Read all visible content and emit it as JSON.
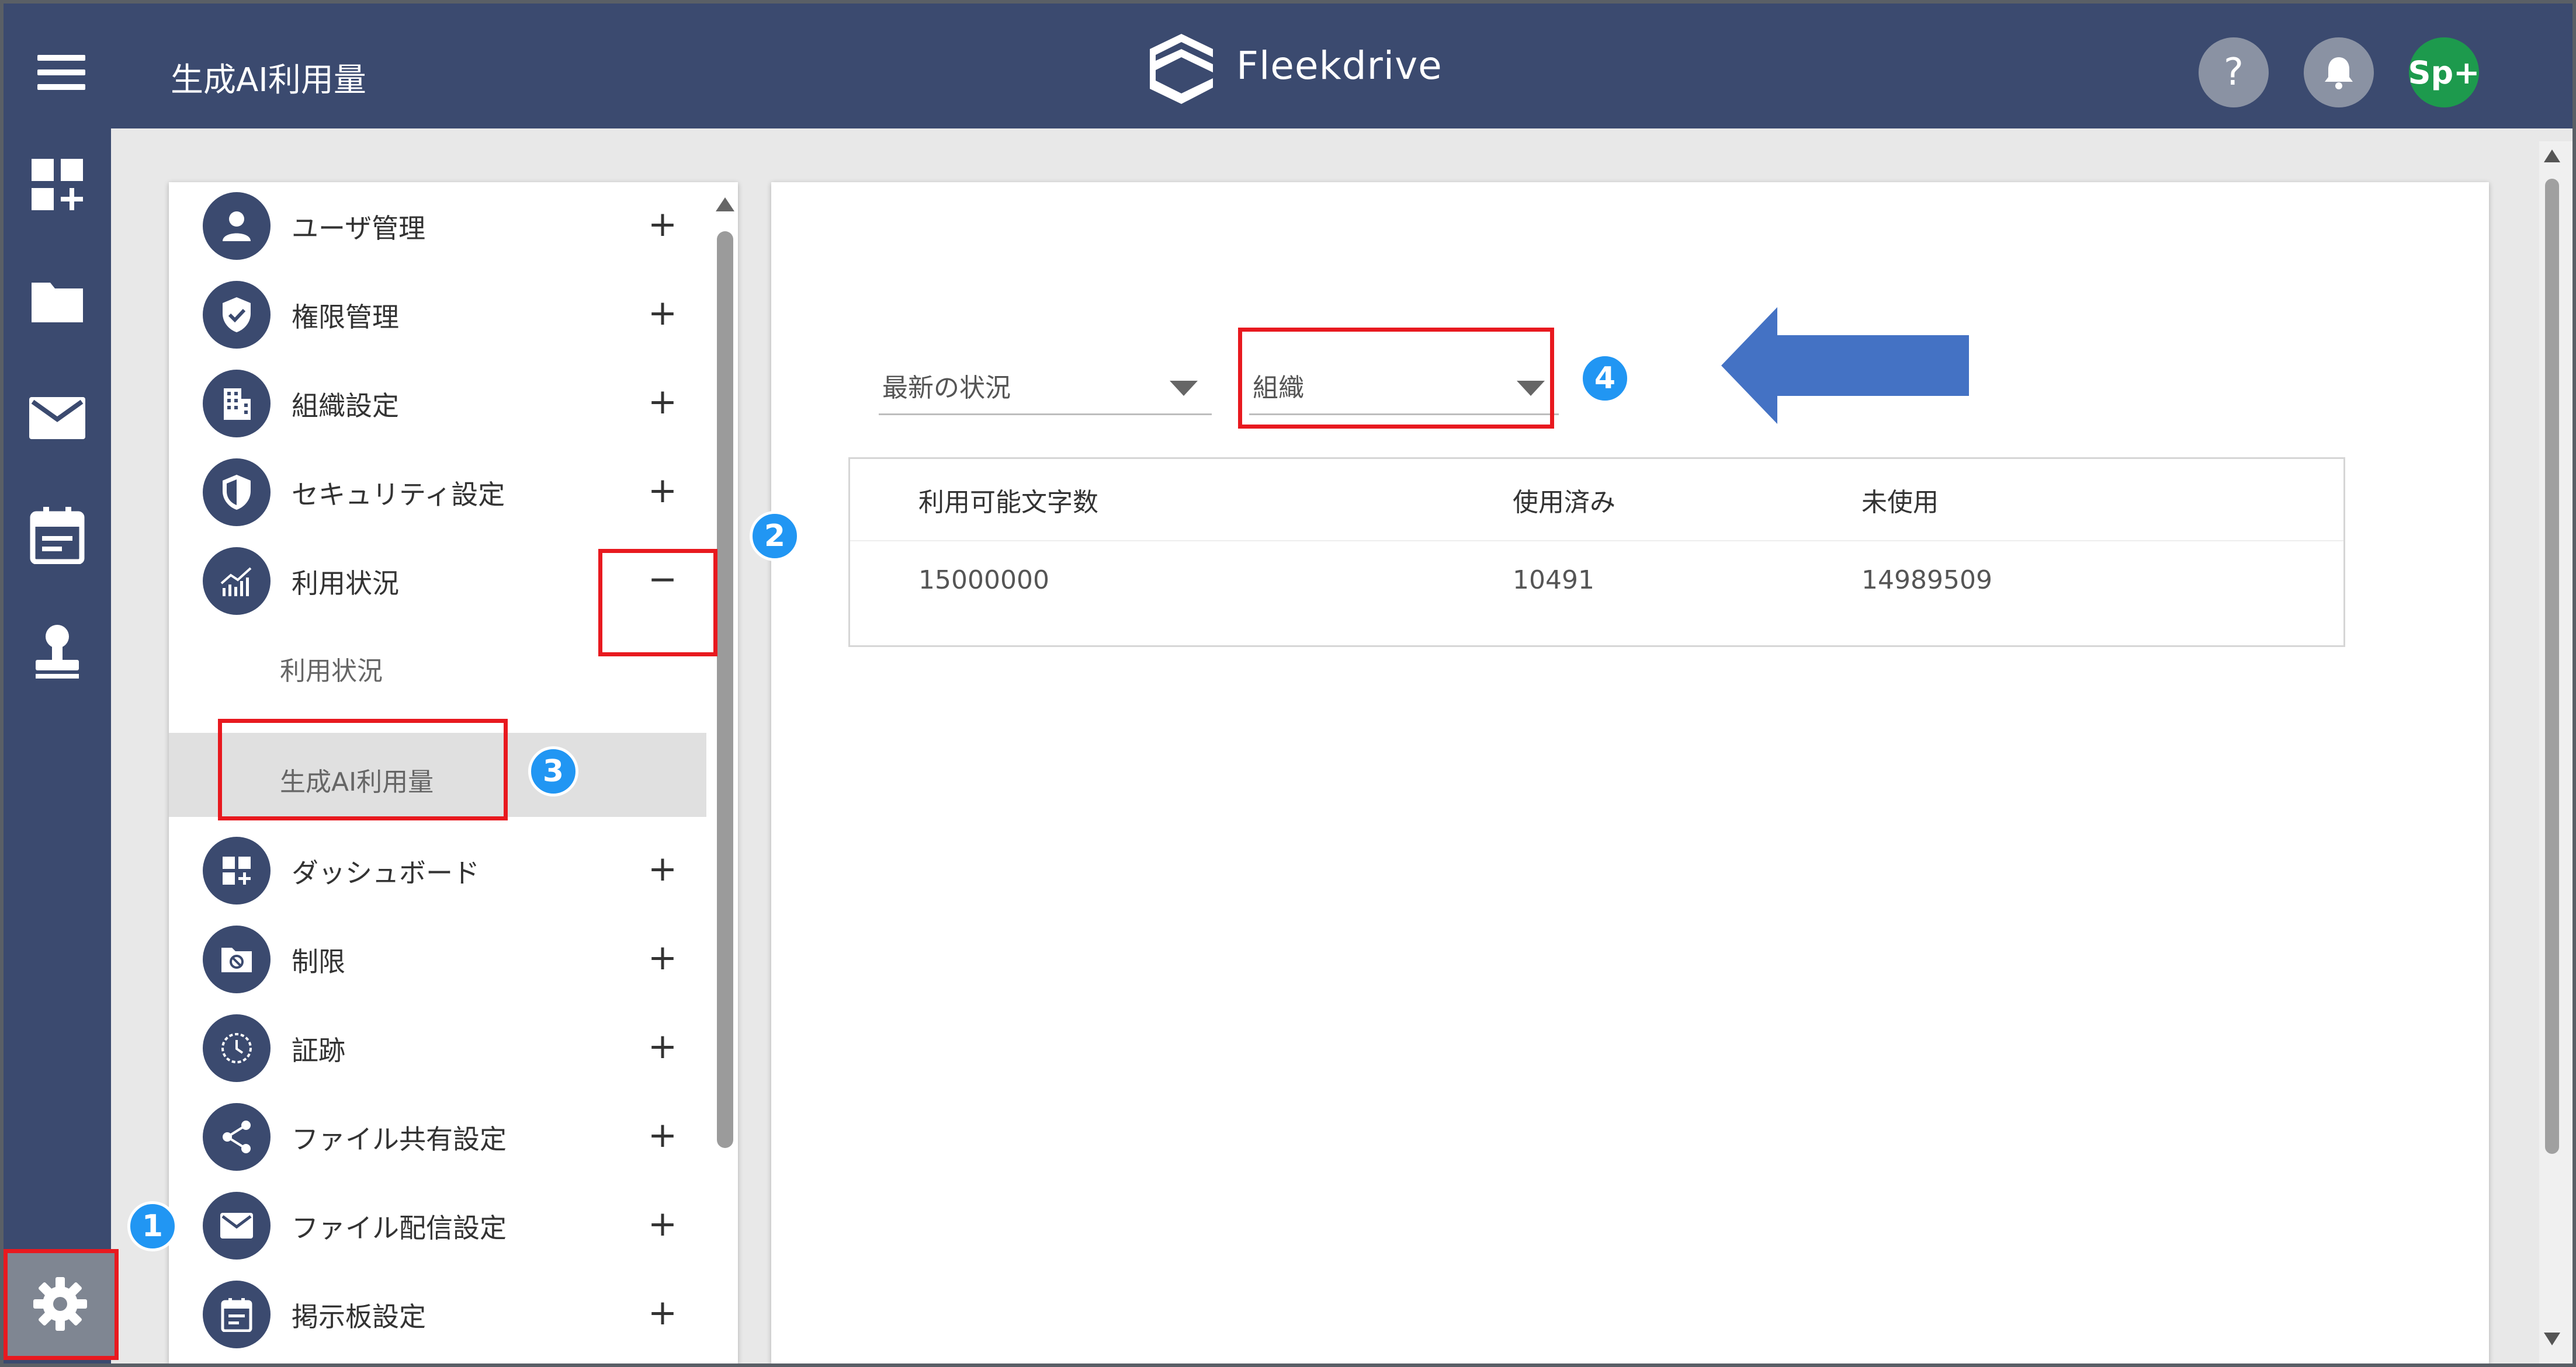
{
  "header": {
    "title": "生成AI利用量",
    "brand": "Fleekdrive",
    "help_label": "?",
    "avatar_label": "Sp+"
  },
  "rail": {
    "items": [
      {
        "icon": "dashboard-add-icon"
      },
      {
        "icon": "folder-icon"
      },
      {
        "icon": "mail-icon"
      },
      {
        "icon": "calendar-board-icon"
      },
      {
        "icon": "stamp-icon"
      }
    ],
    "settings_icon": "gear-icon"
  },
  "sidebar": {
    "items": [
      {
        "label": "ユーザ管理",
        "toggle": "+",
        "icon": "user-icon"
      },
      {
        "label": "権限管理",
        "toggle": "+",
        "icon": "shield-check-icon"
      },
      {
        "label": "組織設定",
        "toggle": "+",
        "icon": "building-icon"
      },
      {
        "label": "セキュリティ設定",
        "toggle": "+",
        "icon": "security-shield-icon"
      },
      {
        "label": "利用状況",
        "toggle": "−",
        "icon": "usage-chart-icon"
      },
      {
        "label": "ダッシュボード",
        "toggle": "+",
        "icon": "dashboard-icon"
      },
      {
        "label": "制限",
        "toggle": "+",
        "icon": "restricted-folder-icon"
      },
      {
        "label": "証跡",
        "toggle": "+",
        "icon": "history-icon"
      },
      {
        "label": "ファイル共有設定",
        "toggle": "+",
        "icon": "share-icon"
      },
      {
        "label": "ファイル配信設定",
        "toggle": "+",
        "icon": "mail-icon"
      },
      {
        "label": "掲示板設定",
        "toggle": "+",
        "icon": "board-icon"
      }
    ],
    "subitems": [
      {
        "label": "利用状況",
        "active": false
      },
      {
        "label": "生成AI利用量",
        "active": true
      }
    ]
  },
  "filters": {
    "period": "最新の状況",
    "scope": "組織"
  },
  "table": {
    "headers": [
      "利用可能文字数",
      "使用済み",
      "未使用"
    ],
    "rows": [
      [
        "15000000",
        "10491",
        "14989509"
      ]
    ]
  },
  "markers": [
    "1",
    "2",
    "3",
    "4"
  ],
  "colors": {
    "header_bg": "#3b4a6f",
    "highlight_red": "#e8191f",
    "marker_blue": "#2196f3",
    "arrow_blue": "#4472c4",
    "avatar_green": "#1d9a4d"
  }
}
